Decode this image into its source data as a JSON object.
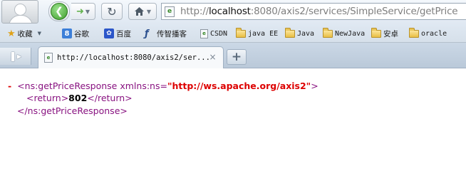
{
  "toolbar": {
    "back_icon": "back-arrow-icon",
    "forward_icon": "forward-arrow-icon",
    "reload_icon": "reload-icon",
    "home_icon": "home-icon",
    "address": {
      "prefix": "http://",
      "host": "localhost",
      "rest": ":8080/axis2/services/SimpleService/getPrice"
    }
  },
  "bookmarks": {
    "items": [
      {
        "label": "收藏",
        "icon": "star-icon"
      },
      {
        "label": "谷歌",
        "icon": "google-icon"
      },
      {
        "label": "百度",
        "icon": "baidu-icon"
      },
      {
        "label": "传智播客",
        "icon": "chuanzhi-icon"
      },
      {
        "label": "CSDN",
        "icon": "page-icon"
      },
      {
        "label": "java EE",
        "icon": "folder-icon"
      },
      {
        "label": "Java",
        "icon": "folder-icon"
      },
      {
        "label": "NewJava",
        "icon": "folder-icon"
      },
      {
        "label": "安卓",
        "icon": "folder-icon"
      },
      {
        "label": "oracle",
        "icon": "folder-icon"
      }
    ]
  },
  "tabs": {
    "active_title": "http://localhost:8080/axis2/ser...",
    "new_tab_symbol": "+"
  },
  "xml": {
    "collapse_marker": "-",
    "root_open": "<ns:getPriceResponse",
    "attr_name": "xmlns:ns=",
    "attr_value": "\"http://ws.apache.org/axis2\"",
    "root_open_end": ">",
    "child_open": "<return>",
    "child_value": "802",
    "child_close": "</return>",
    "root_close": "</ns:getPriceResponse>"
  },
  "colors": {
    "tag": "#881280",
    "attr_value": "#dd0000",
    "collapse_marker": "#dd0000"
  }
}
